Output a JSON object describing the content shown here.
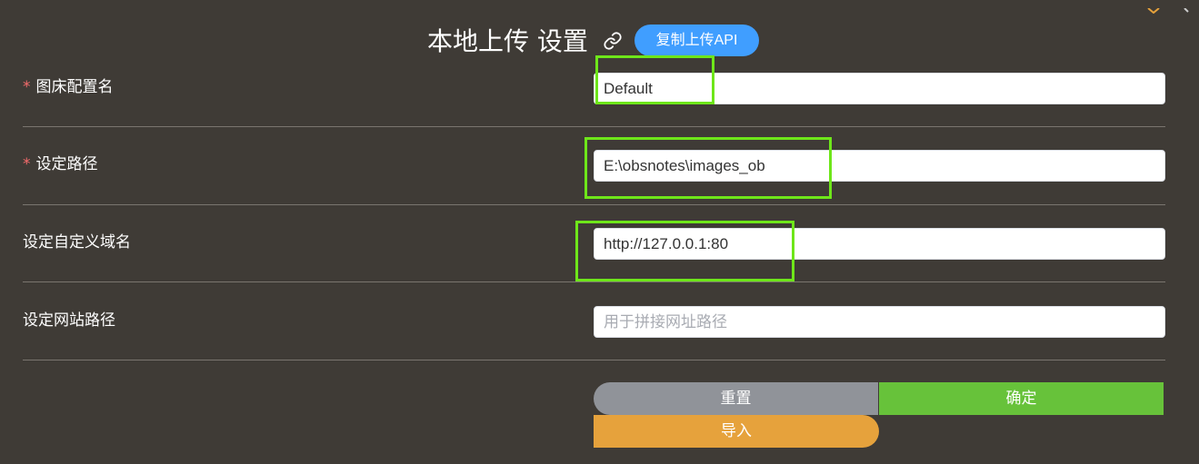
{
  "header": {
    "title": "本地上传 设置",
    "copy_api_label": "复制上传API"
  },
  "form": {
    "rows": [
      {
        "label": "图床配置名",
        "required": "*",
        "value": "Default",
        "placeholder": ""
      },
      {
        "label": "设定路径",
        "required": "*",
        "value": "E:\\obsnotes\\images_ob",
        "placeholder": ""
      },
      {
        "label": "设定自定义域名",
        "required": "",
        "value": "http://127.0.0.1:80",
        "placeholder": ""
      },
      {
        "label": "设定网站路径",
        "required": "",
        "value": "",
        "placeholder": "用于拼接网址路径"
      }
    ]
  },
  "actions": {
    "reset_label": "重置",
    "confirm_label": "确定",
    "import_label": "导入"
  },
  "colors": {
    "background": "#3f3b36",
    "primary": "#409eff",
    "success": "#67c23a",
    "warning": "#e6a23c",
    "info": "#909399",
    "required_mark": "#f56c6c",
    "annotation": "#6ee61a"
  },
  "icons": {
    "title_icon": "link-icon"
  }
}
